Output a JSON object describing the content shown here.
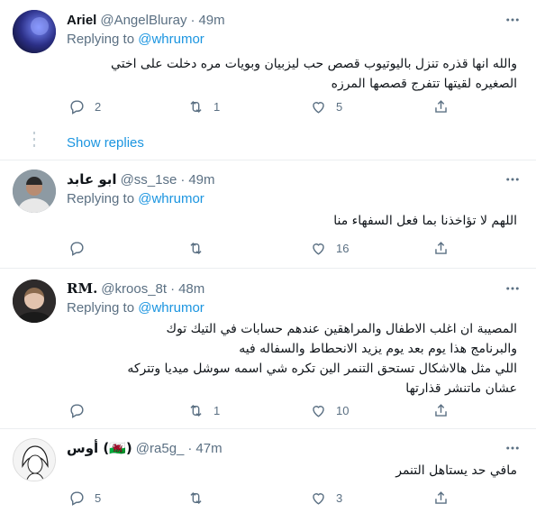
{
  "tweets": [
    {
      "name": "Ariel",
      "handle": "@AngelBluray",
      "sep": "·",
      "time": "49m",
      "replying_prefix": "Replying to",
      "replying_to": "@whrumor",
      "text_lines": [
        "والله انها قذره تنزل باليوتيوب قصص حب ليزبيان وبويات مره دخلت على اختي",
        "الصغيره لقيتها تتفرج قصصها المرزه"
      ],
      "reply_count": "2",
      "retweet_count": "1",
      "like_count": "5",
      "avatar_color": "#2a2e6b",
      "avatar_text": "@Angelbluray"
    },
    {
      "name": "ابو عابد",
      "handle": "@ss_1se",
      "sep": "·",
      "time": "49m",
      "replying_prefix": "Replying to",
      "replying_to": "@whrumor",
      "text_lines": [
        "اللهم لا تؤاخذنا بما فعل السفهاء منا"
      ],
      "reply_count": "",
      "retweet_count": "",
      "like_count": "16",
      "avatar_color": "#6b7a84"
    },
    {
      "name": "RM.",
      "handle": "@kroos_8t",
      "sep": "·",
      "time": "48m",
      "replying_prefix": "Replying to",
      "replying_to": "@whrumor",
      "text_lines": [
        "المصيبة ان اغلب الاطفال والمراهقين عندهم حسابات في التيك توك",
        "والبرنامج هذا يوم بعد يوم يزيد الانحطاط والسفاله فيه",
        "اللي مثل هالاشكال تستحق التنمر الين تكره شي اسمه سوشل ميديا وتتركه",
        "عشان ماتنشر قذارتها"
      ],
      "reply_count": "",
      "retweet_count": "1",
      "like_count": "10",
      "avatar_color": "#3d3a3a"
    },
    {
      "name": "أوس (🏴󠁧󠁢󠁷󠁬󠁳󠁿)",
      "handle": "@ra5g_",
      "sep": "·",
      "time": "47m",
      "replying_prefix": "",
      "replying_to": "",
      "text_lines": [
        "مافي حد يستاهل التنمر"
      ],
      "reply_count": "5",
      "retweet_count": "",
      "like_count": "3",
      "avatar_color": "#f2f2f2"
    }
  ],
  "show_replies": "Show replies",
  "colors": {
    "link": "#1b95e0",
    "muted": "#5b7083",
    "divider": "#ebeef0"
  }
}
